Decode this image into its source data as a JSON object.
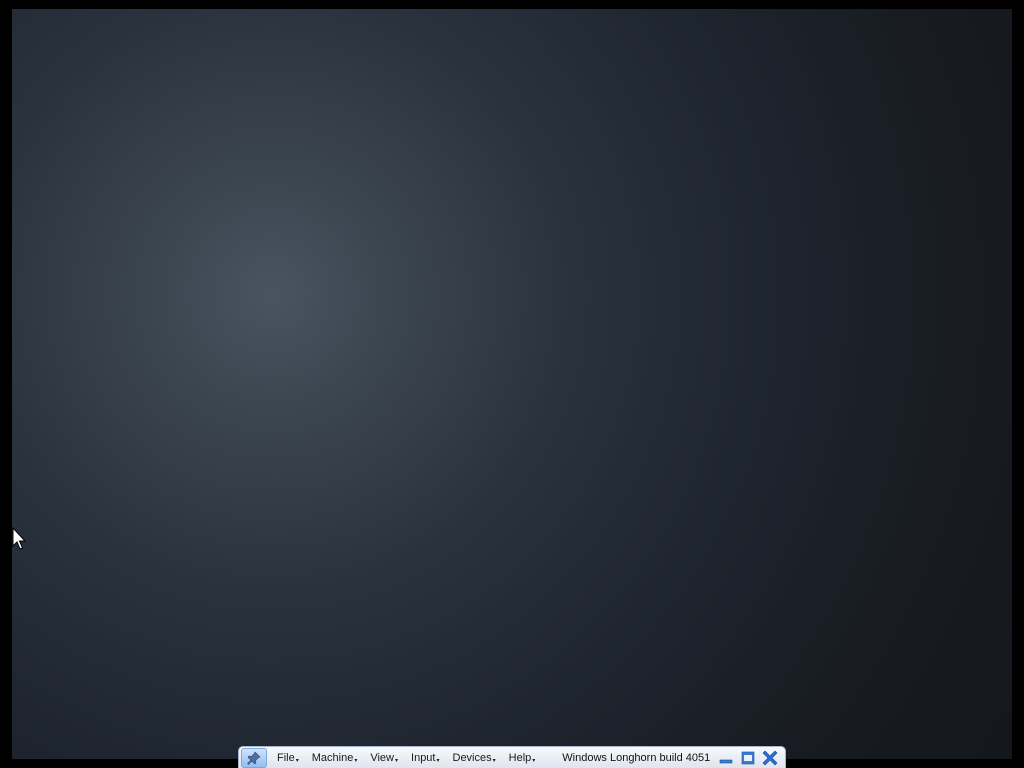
{
  "toolbar": {
    "pin_icon": "pin-icon",
    "menus": [
      {
        "label": "File",
        "arrow": "▾"
      },
      {
        "label": "Machine",
        "arrow": "▾"
      },
      {
        "label": "View",
        "arrow": "▾"
      },
      {
        "label": "Input",
        "arrow": "▾"
      },
      {
        "label": "Devices",
        "arrow": "▾"
      },
      {
        "label": "Help",
        "arrow": "▾"
      }
    ],
    "title": "Windows Longhorn build 4051",
    "buttons": [
      "minimize-icon",
      "restore-icon",
      "close-icon"
    ]
  },
  "colors": {
    "toolbar_accent": "#3a7bd5",
    "close_accent": "#2a6fd6",
    "background_center": "#4a5460",
    "background_edge": "#14171c"
  }
}
